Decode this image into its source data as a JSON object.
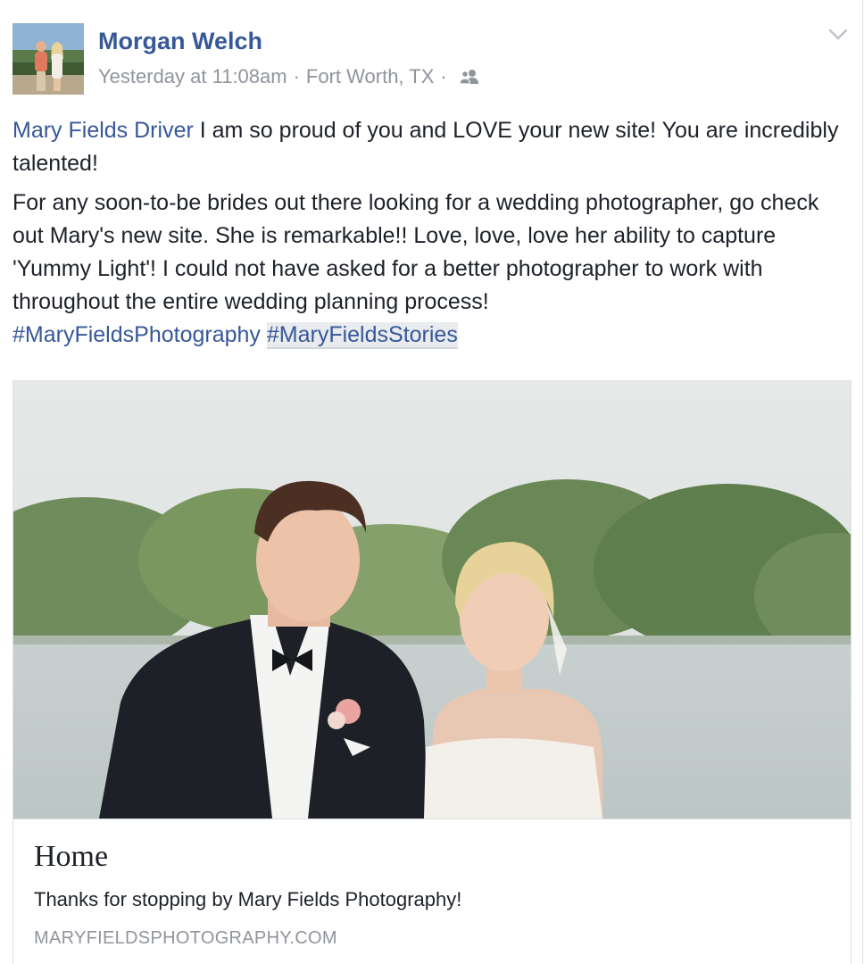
{
  "post": {
    "author": "Morgan Welch",
    "timestamp": "Yesterday at 11:08am",
    "location": "Fort Worth, TX",
    "separator": "·",
    "audience_icon": "friends-icon",
    "menu_icon": "chevron-down-icon",
    "paragraph1": {
      "mention": "Mary Fields Driver",
      "text": " I am so proud of you and LOVE your new site! You are incredibly talented!"
    },
    "paragraph2": {
      "text": "For any soon-to-be brides out there looking for a wedding photographer, go check out Mary's new site. She is remarkable!! Love, love, love her ability to capture 'Yummy Light'! I could not have asked for a better photographer to work with throughout the entire wedding planning process!",
      "hashtag1": "#MaryFieldsPhotography",
      "hashtag2": "#MaryFieldsStories"
    }
  },
  "link_preview": {
    "image_icon": "wedding-photo",
    "title": "Home",
    "description": "Thanks for stopping by Mary Fields Photography!",
    "domain": "MARYFIELDSPHOTOGRAPHY.COM"
  },
  "colors": {
    "link_blue": "#365899",
    "meta_gray": "#90949c",
    "text": "#1d2129",
    "border": "#dddfe2"
  }
}
